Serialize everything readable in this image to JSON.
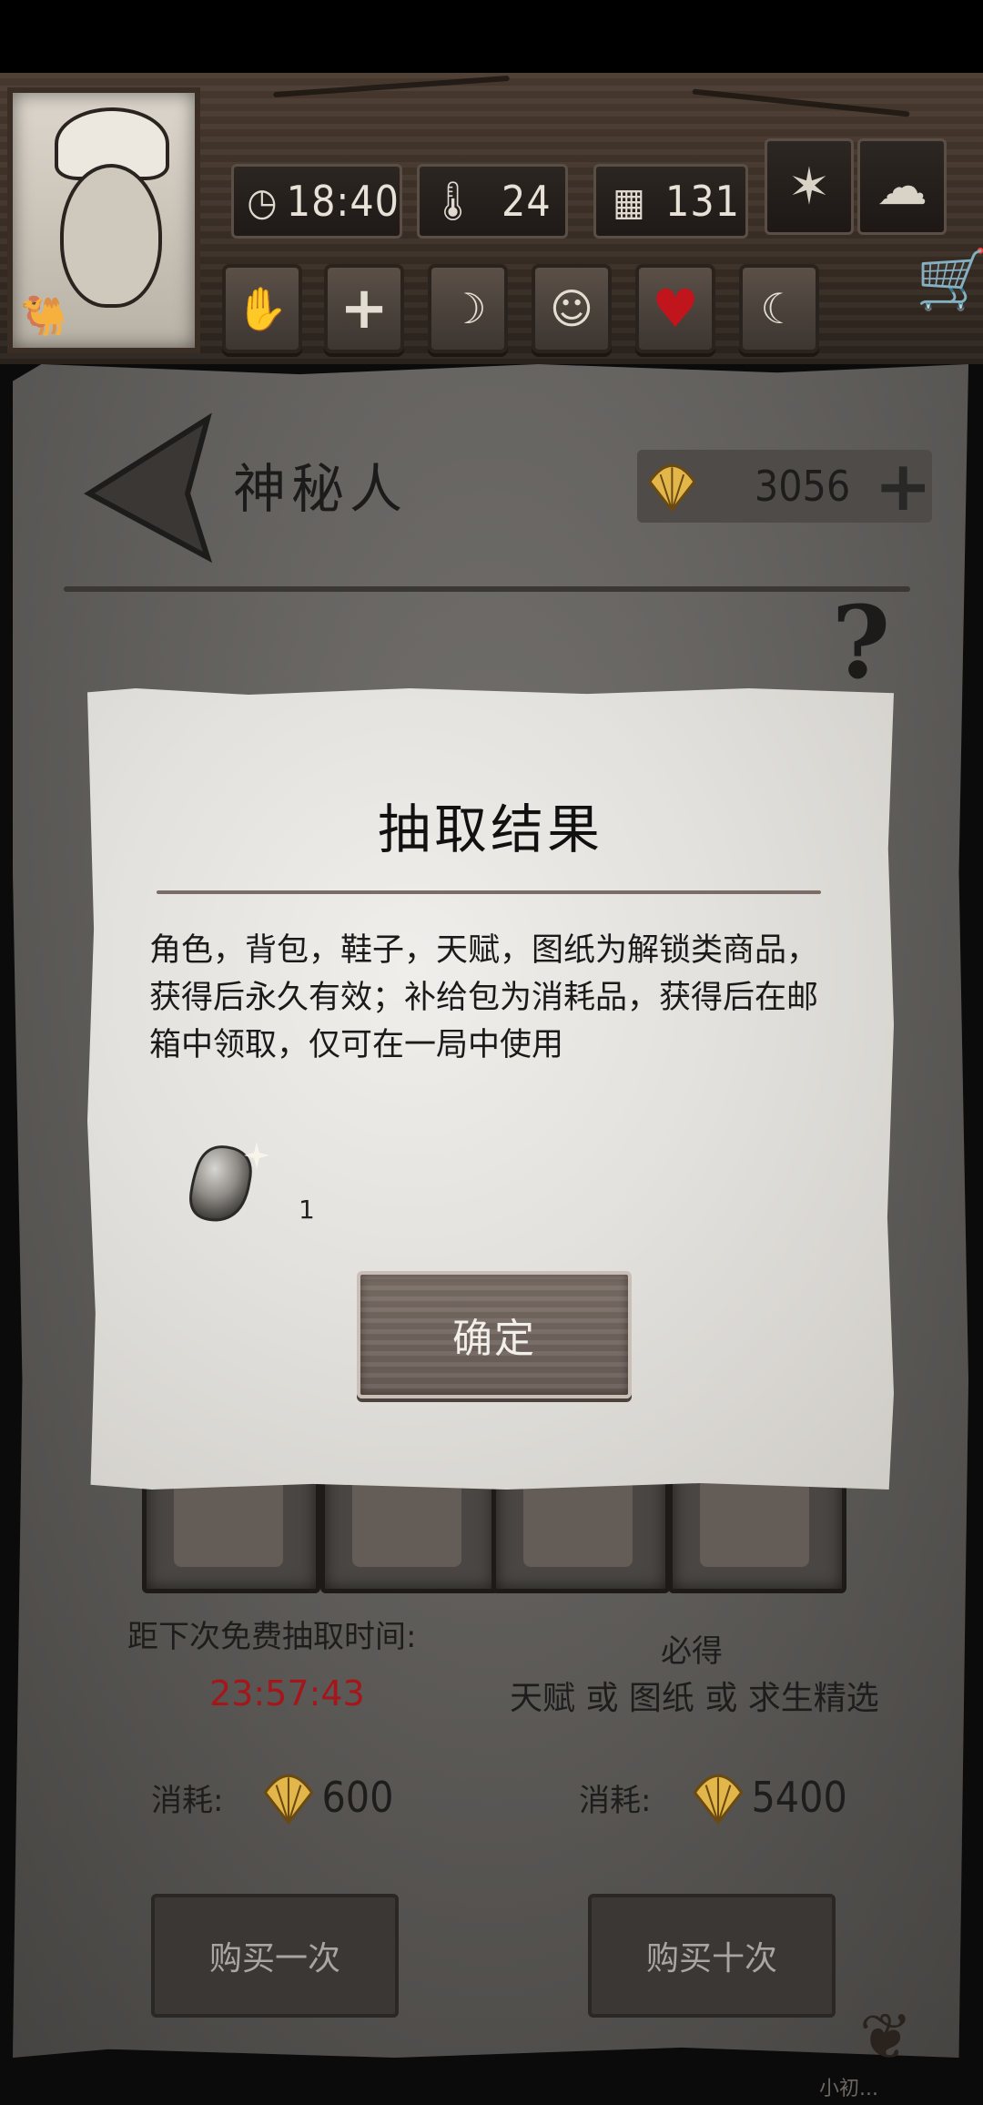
{
  "hud": {
    "time": "18:40",
    "temperature": "24",
    "day": "131",
    "weather_icons": [
      "leaf-icon",
      "cloud-icon"
    ],
    "need_icons": [
      "hand-icon",
      "health-plus-icon",
      "stomach-icon",
      "head-icon",
      "heart-icon",
      "moon-icon"
    ],
    "heart_color": "#c0151d"
  },
  "page": {
    "title": "神秘人",
    "shell_balance": "3056",
    "help": "?"
  },
  "offer": {
    "free_label": "距下次免费抽取时间:",
    "timer": "23:57:43",
    "timer_color": "#a4161a",
    "guarantee_title": "必得",
    "guarantee_text": "天赋 或 图纸 或 求生精选",
    "single_cost_label": "消耗:",
    "single_cost": "600",
    "ten_cost_label": "消耗:",
    "ten_cost": "5400",
    "buy_once": "购买一次",
    "buy_ten": "购买十次"
  },
  "dialog": {
    "title": "抽取结果",
    "description": "角色，背包，鞋子，天赋，图纸为解锁类商品，获得后永久有效；补给包为消耗品，获得后在邮箱中领取，仅可在一局中使用",
    "reward_count": "1",
    "confirm": "确定"
  },
  "footer": {
    "watermark": "小初..."
  }
}
